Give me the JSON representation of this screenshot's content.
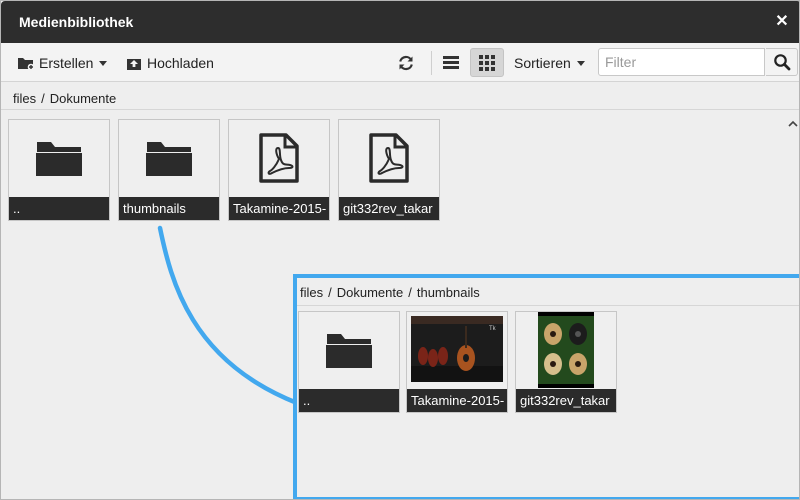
{
  "dialog": {
    "title": "Medienbibliothek",
    "close_icon": "close-icon"
  },
  "toolbar": {
    "create_label": "Erstellen",
    "upload_label": "Hochladen",
    "sort_label": "Sortieren",
    "filter_placeholder": "Filter",
    "filter_value": "",
    "icons": {
      "create": "folder-add-icon",
      "upload": "upload-icon",
      "refresh": "refresh-icon",
      "list_view": "list-view-icon",
      "grid_view": "grid-view-icon",
      "search": "search-icon"
    },
    "active_view": "grid"
  },
  "breadcrumb": {
    "items": [
      "files",
      "Dokumente"
    ]
  },
  "files": [
    {
      "name": "..",
      "type": "folder"
    },
    {
      "name": "thumbnails",
      "type": "folder"
    },
    {
      "name": "Takamine-2015-",
      "type": "pdf"
    },
    {
      "name": "git332rev_takar",
      "type": "pdf"
    }
  ],
  "inset": {
    "breadcrumb": [
      "files",
      "Dokumente",
      "thumbnails"
    ],
    "files": [
      {
        "name": "..",
        "type": "folder"
      },
      {
        "name": "Takamine-2015-",
        "type": "image"
      },
      {
        "name": "git332rev_takar",
        "type": "image"
      }
    ]
  },
  "colors": {
    "titlebar": "#2d2d2d",
    "label_bg": "#2b2b2b",
    "highlight": "#42a8ee"
  }
}
